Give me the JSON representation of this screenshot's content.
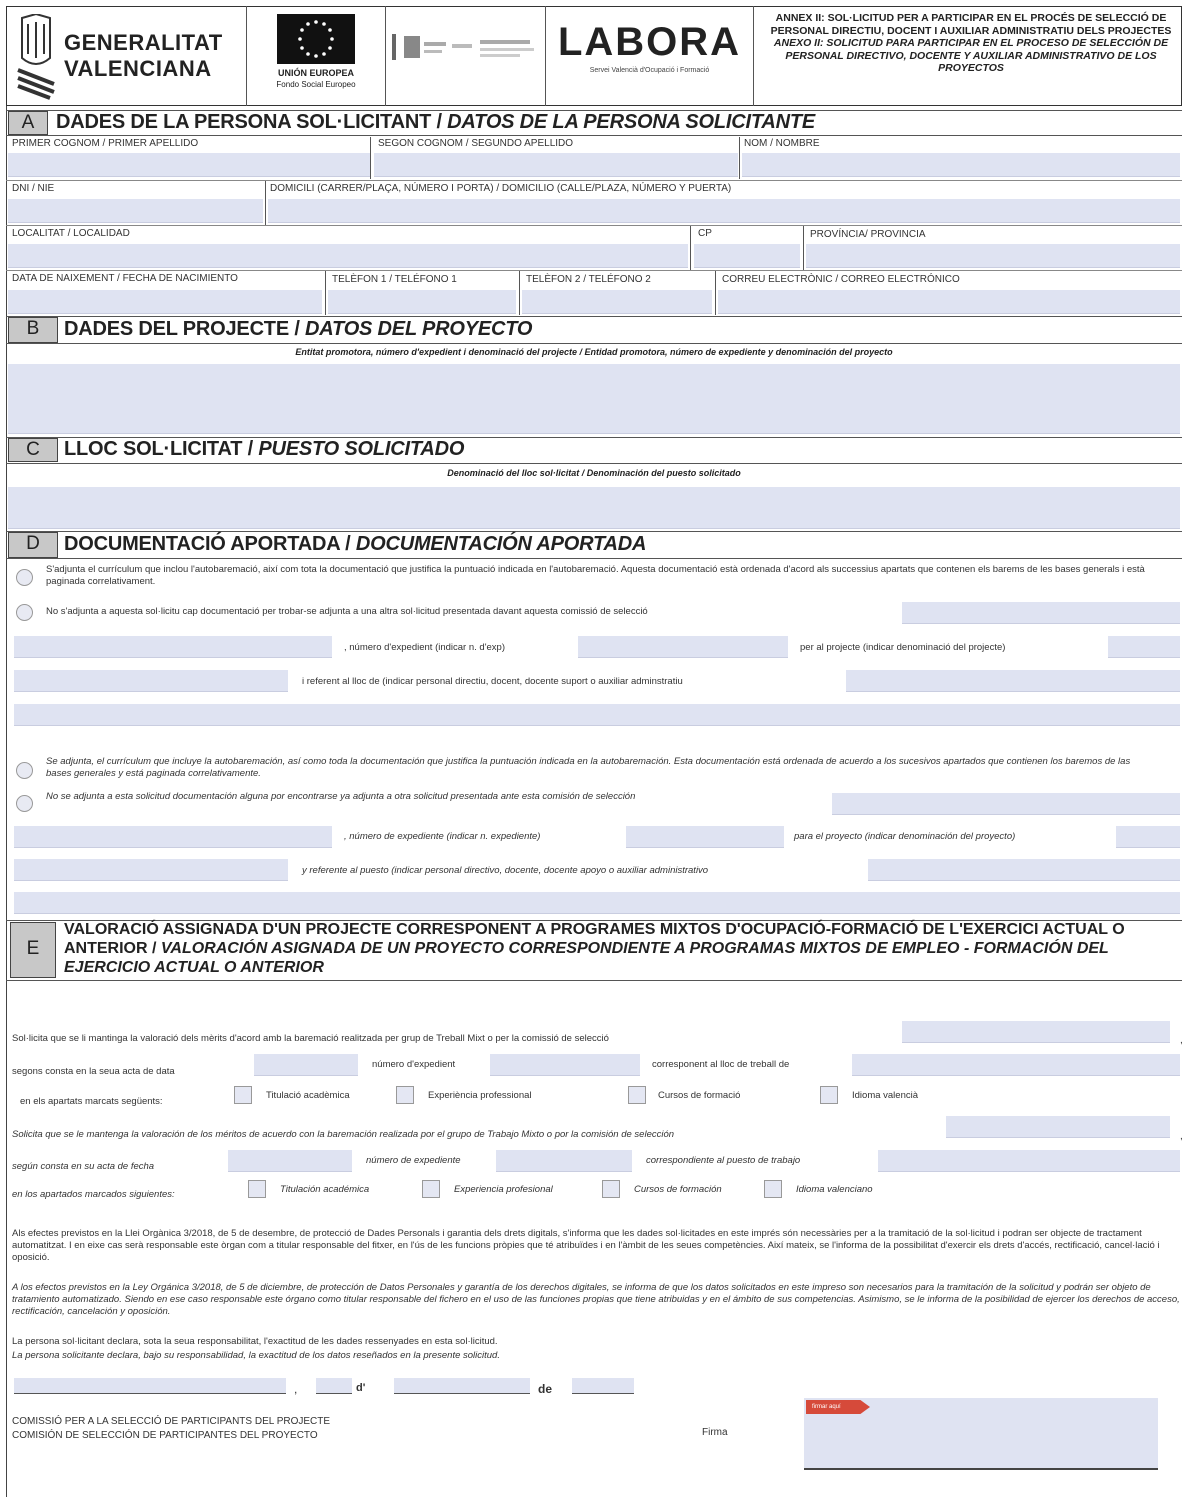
{
  "header": {
    "gva_line1": "GENERALITAT",
    "gva_line2": "VALENCIANA",
    "eu_line1": "UNIÓN EUROPEA",
    "eu_line2": "Fondo Social Europeo",
    "labora": "LABORA",
    "labora_sub": "Servei Valencià d'Ocupació i Formació",
    "annex_va": "ANNEX II: SOL·LICITUD PER A PARTICIPAR EN EL PROCÉS DE SELECCIÓ DE PERSONAL DIRECTIU, DOCENT I AUXILIAR ADMINISTRATIU DELS PROJECTES",
    "annex_es": "ANEXO II: SOLICITUD PARA PARTICIPAR EN EL PROCESO DE SELECCIÓN DE PERSONAL DIRECTIVO, DOCENTE Y AUXILIAR ADMINISTRATIVO DE LOS PROYECTOS"
  },
  "sectionA": {
    "letter": "A",
    "title_va": "DADES DE LA PERSONA SOL·LICITANT /",
    "title_es": "DATOS DE LA PERSONA SOLICITANTE",
    "f1": "PRIMER COGNOM / PRIMER APELLIDO",
    "f2": "SEGON COGNOM / SEGUNDO APELLIDO",
    "f3": "NOM / NOMBRE",
    "f4": "DNI / NIE",
    "f5": "DOMICILI (CARRER/PLAÇA, NÚMERO I PORTA) / DOMICILIO (CALLE/PLAZA, NÚMERO Y PUERTA)",
    "f6": "LOCALITAT / LOCALIDAD",
    "f7": "CP",
    "f8": "PROVÍNCIA/ PROVINCIA",
    "f9": "DATA DE NAIXEMENT / FECHA DE NACIMIENTO",
    "f10": "TELÈFON 1 / TELÉFONO 1",
    "f11": "TELÈFON 2 / TELÉFONO 2",
    "f12": "CORREU ELECTRÒNIC / CORREO ELECTRÓNICO"
  },
  "sectionB": {
    "letter": "B",
    "title_va": "DADES DEL PROJECTE /",
    "title_es": "DATOS DEL PROYECTO",
    "sub": "Entitat promotora, número d'expedient i denominació del projecte / Entidad promotora, número de expediente y denominación del proyecto"
  },
  "sectionC": {
    "letter": "C",
    "title_va": "LLOC SOL·LICITAT /",
    "title_es": "PUESTO SOLICITADO",
    "sub": "Denominació del lloc sol·licitat / Denominación del puesto solicitado"
  },
  "sectionD": {
    "letter": "D",
    "title_va": "DOCUMENTACIÓ APORTADA /",
    "title_es": "DOCUMENTACIÓN APORTADA",
    "opt1_va": "S'adjunta el currículum que inclou l'autobaremació, així com tota la documentació que justifica la puntuació indicada en l'autobaremació. Aquesta documentació està ordenada d'acord als successius apartats que contenen els barems de les bases generals i està paginada correlativament.",
    "opt2_va": "No s'adjunta a aquesta sol·licitu cap documentació per trobar-se adjunta a una altra sol·licitud presentada davant aquesta comissió de selecció",
    "exp_va": ", número d'expedient (indicar n. d'exp)",
    "proj_va": "per al projecte (indicar denominació del projecte)",
    "ref_va": "i referent al lloc de (indicar personal directiu, docent, docente suport o auxiliar adminstratiu",
    "opt1_es": "Se adjunta, el currículum que incluye la autobaremación, así como toda la documentación que justifica la puntuación indicada en la autobaremación. Esta documentación está ordenada de acuerdo a los sucesivos apartados que contienen los baremos de las bases generales y está paginada correlativamente.",
    "opt2_es": "No se adjunta a esta solicitud documentación alguna por encontrarse ya adjunta a otra solicitud presentada ante esta comisión de selección",
    "exp_es": ", número de expediente (indicar n. expediente)",
    "proj_es": "para el proyecto (indicar denominación del proyecto)",
    "ref_es": "y referente al puesto (indicar personal directivo, docente, docente apoyo o auxiliar administrativo"
  },
  "sectionE": {
    "letter": "E",
    "title_va": "VALORACIÓ ASSIGNADA D'UN PROJECTE CORRESPONENT A PROGRAMES MIXTOS D'OCUPACIÓ-FORMACIÓ DE L'EXERCICI ACTUAL O ANTERIOR /",
    "title_es": "VALORACIÓN ASIGNADA DE UN PROYECTO CORRESPONDIENTE A PROGRAMAS MIXTOS DE EMPLEO - FORMACIÓN DEL EJERCICIO ACTUAL O ANTERIOR",
    "l1_va": "Sol·licita que se li mantinga la valoració dels mèrits d'acord amb la baremació realitzada per grup de Treball Mixt o per la comissió de selecció",
    "l2_va_a": "segons consta en la seua acta de data",
    "l2_va_b": "número d'expedient",
    "l2_va_c": "corresponent al lloc de treball de",
    "l3_va": "en els apartats marcats següents:",
    "c1_va": "Titulació acadèmica",
    "c2_va": "Experiència professional",
    "c3_va": "Cursos de formació",
    "c4_va": "Idioma valencià",
    "l1_es": "Solicita que se le mantenga la valoración de los méritos de acuerdo con la baremación realizada por el grupo de Trabajo Mixto o por la comisión de selección",
    "l2_es_a": "según consta en su acta de fecha",
    "l2_es_b": "número de expediente",
    "l2_es_c": "correspondiente al puesto de trabajo",
    "l3_es": "en los apartados marcados siguientes:",
    "c1_es": "Titulación académica",
    "c2_es": "Experiencia profesional",
    "c3_es": "Cursos de formación",
    "c4_es": "Idioma valenciano"
  },
  "legal": {
    "va": "Als efectes previstos en la Llei Orgànica 3/2018, de 5 de desembre, de protecció de Dades Personals i garantia dels drets digitals, s'informa que les dades sol·licitades en este imprés són necessàries per a la tramitació de la sol·licitud i podran ser objecte de tractament automatitzat. I en eixe cas serà responsable este òrgan com a titular responsable del fitxer, en l'ús de les funcions pròpies que té atribuïdes i en l'àmbit de les seues competències. Així mateix, se l'informa de la possibilitat d'exercir els drets d'accés, rectificació, cancel·lació i oposició.",
    "es": "A los efectos previstos en la Ley Orgánica 3/2018, de 5 de diciembre, de protección de Datos Personales y garantía de los derechos digitales, se informa de que los datos solicitados en este impreso son necesarios para la tramitación de la solicitud y podrán ser objeto de tratamiento automatizado. Siendo en ese caso responsable este órgano como titular responsable del fichero en el uso de las funciones propias que tiene atribuidas y en el ámbito de sus competencias. Asimismo, se le informa de la posibilidad de ejercer los derechos de acceso, rectificación, cancelación y oposición.",
    "decl_va": "La persona sol·licitant declara, sota la seua responsabilitat, l'exactitud de les dades ressenyades en esta sol·licitud.",
    "decl_es": "La persona solicitante declara, bajo su responsabilidad, la exactitud de los datos reseñados en la presente solicitud."
  },
  "footer": {
    "comma": ",",
    "d": "d'",
    "de": "de",
    "com_va": "COMISSIÓ PER A LA SELECCIÓ DE PARTICIPANTS DEL PROJECTE",
    "com_es": "COMISIÓN DE SELECCIÓN DE PARTICIPANTES DEL PROYECTO",
    "firma": "Firma",
    "firma_tag": "firmar aquí"
  }
}
